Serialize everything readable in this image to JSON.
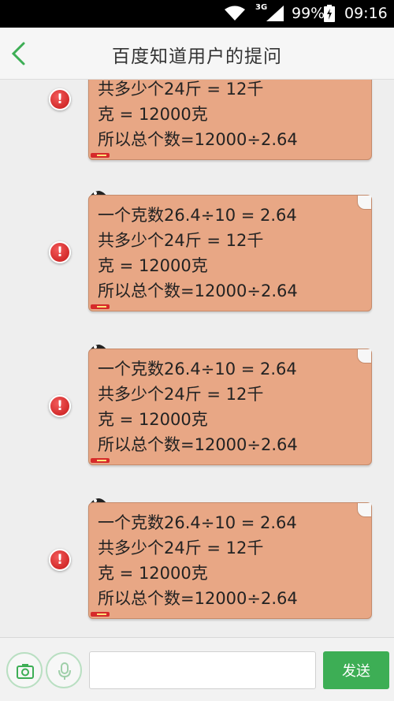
{
  "status_bar": {
    "network": "3G",
    "battery_percent": "99%",
    "time": "09:16"
  },
  "header": {
    "title": "百度知道用户的提问"
  },
  "messages": [
    {
      "lines": [
        "共多少个24斤 = 12千",
        "克 = 12000克",
        "所以总个数=12000÷2.64"
      ]
    },
    {
      "lines": [
        "一个克数26.4÷10 = 2.64",
        "共多少个24斤 = 12千",
        "克 = 12000克",
        "所以总个数=12000÷2.64"
      ]
    },
    {
      "lines": [
        "一个克数26.4÷10 = 2.64",
        "共多少个24斤 = 12千",
        "克 = 12000克",
        "所以总个数=12000÷2.64"
      ]
    },
    {
      "lines": [
        "一个克数26.4÷10 = 2.64",
        "共多少个24斤 = 12千",
        "克 = 12000克",
        "所以总个数=12000÷2.64"
      ]
    }
  ],
  "error_symbol": "!",
  "input_bar": {
    "text_value": "",
    "send_label": "发送"
  },
  "colors": {
    "bubble": "#e8a785",
    "send_button": "#3dae55",
    "error": "#d42020",
    "accent": "#3dae55"
  }
}
